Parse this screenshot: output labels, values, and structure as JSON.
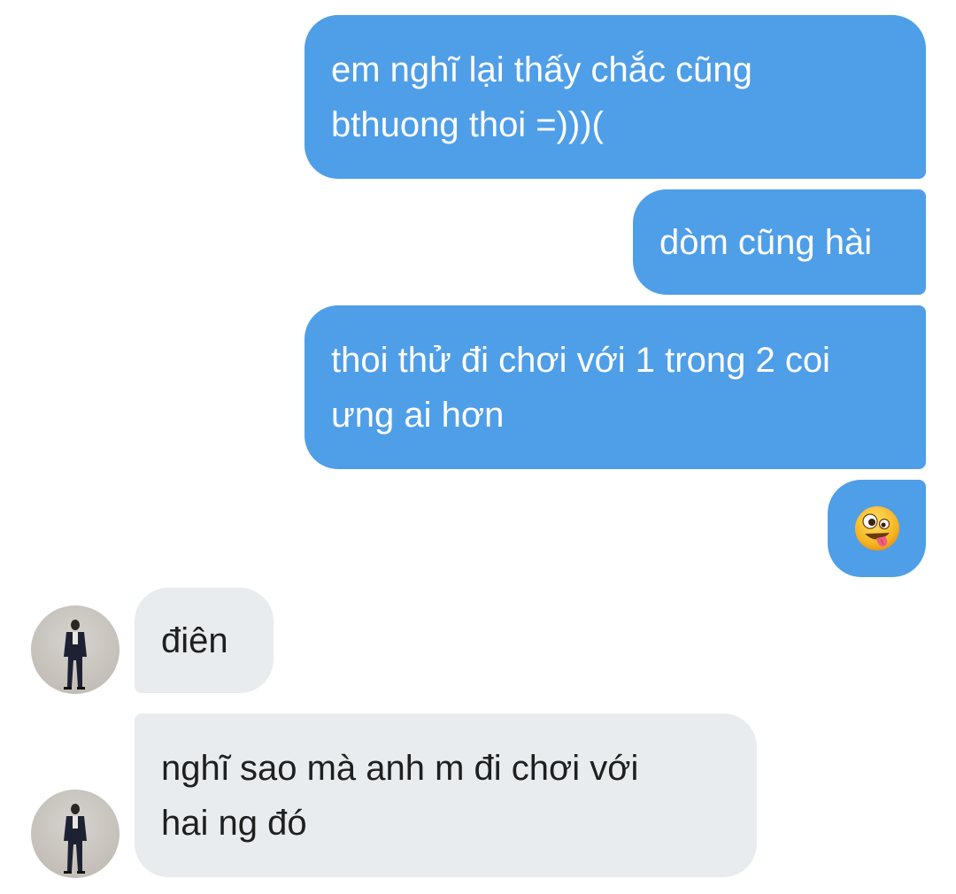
{
  "conversation": {
    "messages": [
      {
        "direction": "sent",
        "text": "em nghĩ lại thấy chắc cũng\nbthuong thoi =)))("
      },
      {
        "direction": "sent",
        "text": "dòm cũng hài"
      },
      {
        "direction": "sent",
        "text": "thoi thử đi chơi với 1 trong 2 coi\nưng ai hơn"
      },
      {
        "direction": "sent",
        "emoji": "zany-face"
      },
      {
        "direction": "received",
        "text": "điên"
      },
      {
        "direction": "received",
        "text": "nghĩ sao mà anh m đi chơi với\nhai ng đó"
      }
    ]
  },
  "theme": {
    "sent_bubble_color": "#4f9ee8",
    "received_bubble_color": "#e8ecef",
    "sent_text_color": "#ffffff",
    "received_text_color": "#1f1f1f"
  }
}
